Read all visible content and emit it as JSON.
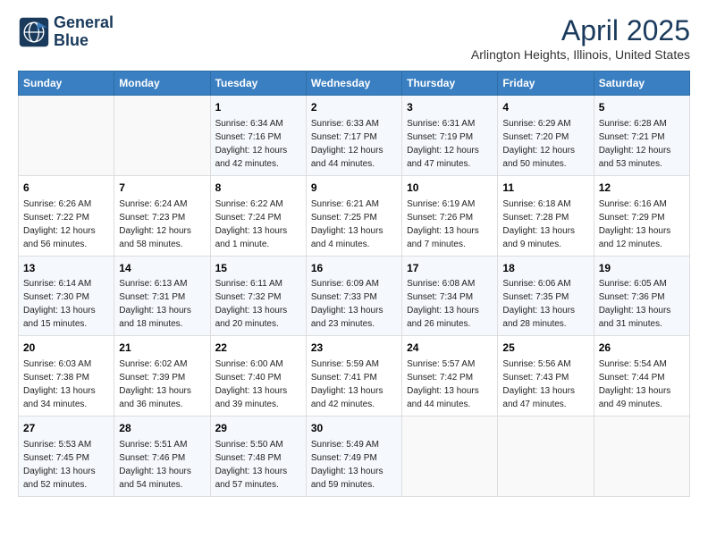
{
  "header": {
    "logo_line1": "General",
    "logo_line2": "Blue",
    "main_title": "April 2025",
    "subtitle": "Arlington Heights, Illinois, United States"
  },
  "days_of_week": [
    "Sunday",
    "Monday",
    "Tuesday",
    "Wednesday",
    "Thursday",
    "Friday",
    "Saturday"
  ],
  "weeks": [
    [
      {
        "day": "",
        "info": ""
      },
      {
        "day": "",
        "info": ""
      },
      {
        "day": "1",
        "info": "Sunrise: 6:34 AM\nSunset: 7:16 PM\nDaylight: 12 hours and 42 minutes."
      },
      {
        "day": "2",
        "info": "Sunrise: 6:33 AM\nSunset: 7:17 PM\nDaylight: 12 hours and 44 minutes."
      },
      {
        "day": "3",
        "info": "Sunrise: 6:31 AM\nSunset: 7:19 PM\nDaylight: 12 hours and 47 minutes."
      },
      {
        "day": "4",
        "info": "Sunrise: 6:29 AM\nSunset: 7:20 PM\nDaylight: 12 hours and 50 minutes."
      },
      {
        "day": "5",
        "info": "Sunrise: 6:28 AM\nSunset: 7:21 PM\nDaylight: 12 hours and 53 minutes."
      }
    ],
    [
      {
        "day": "6",
        "info": "Sunrise: 6:26 AM\nSunset: 7:22 PM\nDaylight: 12 hours and 56 minutes."
      },
      {
        "day": "7",
        "info": "Sunrise: 6:24 AM\nSunset: 7:23 PM\nDaylight: 12 hours and 58 minutes."
      },
      {
        "day": "8",
        "info": "Sunrise: 6:22 AM\nSunset: 7:24 PM\nDaylight: 13 hours and 1 minute."
      },
      {
        "day": "9",
        "info": "Sunrise: 6:21 AM\nSunset: 7:25 PM\nDaylight: 13 hours and 4 minutes."
      },
      {
        "day": "10",
        "info": "Sunrise: 6:19 AM\nSunset: 7:26 PM\nDaylight: 13 hours and 7 minutes."
      },
      {
        "day": "11",
        "info": "Sunrise: 6:18 AM\nSunset: 7:28 PM\nDaylight: 13 hours and 9 minutes."
      },
      {
        "day": "12",
        "info": "Sunrise: 6:16 AM\nSunset: 7:29 PM\nDaylight: 13 hours and 12 minutes."
      }
    ],
    [
      {
        "day": "13",
        "info": "Sunrise: 6:14 AM\nSunset: 7:30 PM\nDaylight: 13 hours and 15 minutes."
      },
      {
        "day": "14",
        "info": "Sunrise: 6:13 AM\nSunset: 7:31 PM\nDaylight: 13 hours and 18 minutes."
      },
      {
        "day": "15",
        "info": "Sunrise: 6:11 AM\nSunset: 7:32 PM\nDaylight: 13 hours and 20 minutes."
      },
      {
        "day": "16",
        "info": "Sunrise: 6:09 AM\nSunset: 7:33 PM\nDaylight: 13 hours and 23 minutes."
      },
      {
        "day": "17",
        "info": "Sunrise: 6:08 AM\nSunset: 7:34 PM\nDaylight: 13 hours and 26 minutes."
      },
      {
        "day": "18",
        "info": "Sunrise: 6:06 AM\nSunset: 7:35 PM\nDaylight: 13 hours and 28 minutes."
      },
      {
        "day": "19",
        "info": "Sunrise: 6:05 AM\nSunset: 7:36 PM\nDaylight: 13 hours and 31 minutes."
      }
    ],
    [
      {
        "day": "20",
        "info": "Sunrise: 6:03 AM\nSunset: 7:38 PM\nDaylight: 13 hours and 34 minutes."
      },
      {
        "day": "21",
        "info": "Sunrise: 6:02 AM\nSunset: 7:39 PM\nDaylight: 13 hours and 36 minutes."
      },
      {
        "day": "22",
        "info": "Sunrise: 6:00 AM\nSunset: 7:40 PM\nDaylight: 13 hours and 39 minutes."
      },
      {
        "day": "23",
        "info": "Sunrise: 5:59 AM\nSunset: 7:41 PM\nDaylight: 13 hours and 42 minutes."
      },
      {
        "day": "24",
        "info": "Sunrise: 5:57 AM\nSunset: 7:42 PM\nDaylight: 13 hours and 44 minutes."
      },
      {
        "day": "25",
        "info": "Sunrise: 5:56 AM\nSunset: 7:43 PM\nDaylight: 13 hours and 47 minutes."
      },
      {
        "day": "26",
        "info": "Sunrise: 5:54 AM\nSunset: 7:44 PM\nDaylight: 13 hours and 49 minutes."
      }
    ],
    [
      {
        "day": "27",
        "info": "Sunrise: 5:53 AM\nSunset: 7:45 PM\nDaylight: 13 hours and 52 minutes."
      },
      {
        "day": "28",
        "info": "Sunrise: 5:51 AM\nSunset: 7:46 PM\nDaylight: 13 hours and 54 minutes."
      },
      {
        "day": "29",
        "info": "Sunrise: 5:50 AM\nSunset: 7:48 PM\nDaylight: 13 hours and 57 minutes."
      },
      {
        "day": "30",
        "info": "Sunrise: 5:49 AM\nSunset: 7:49 PM\nDaylight: 13 hours and 59 minutes."
      },
      {
        "day": "",
        "info": ""
      },
      {
        "day": "",
        "info": ""
      },
      {
        "day": "",
        "info": ""
      }
    ]
  ]
}
